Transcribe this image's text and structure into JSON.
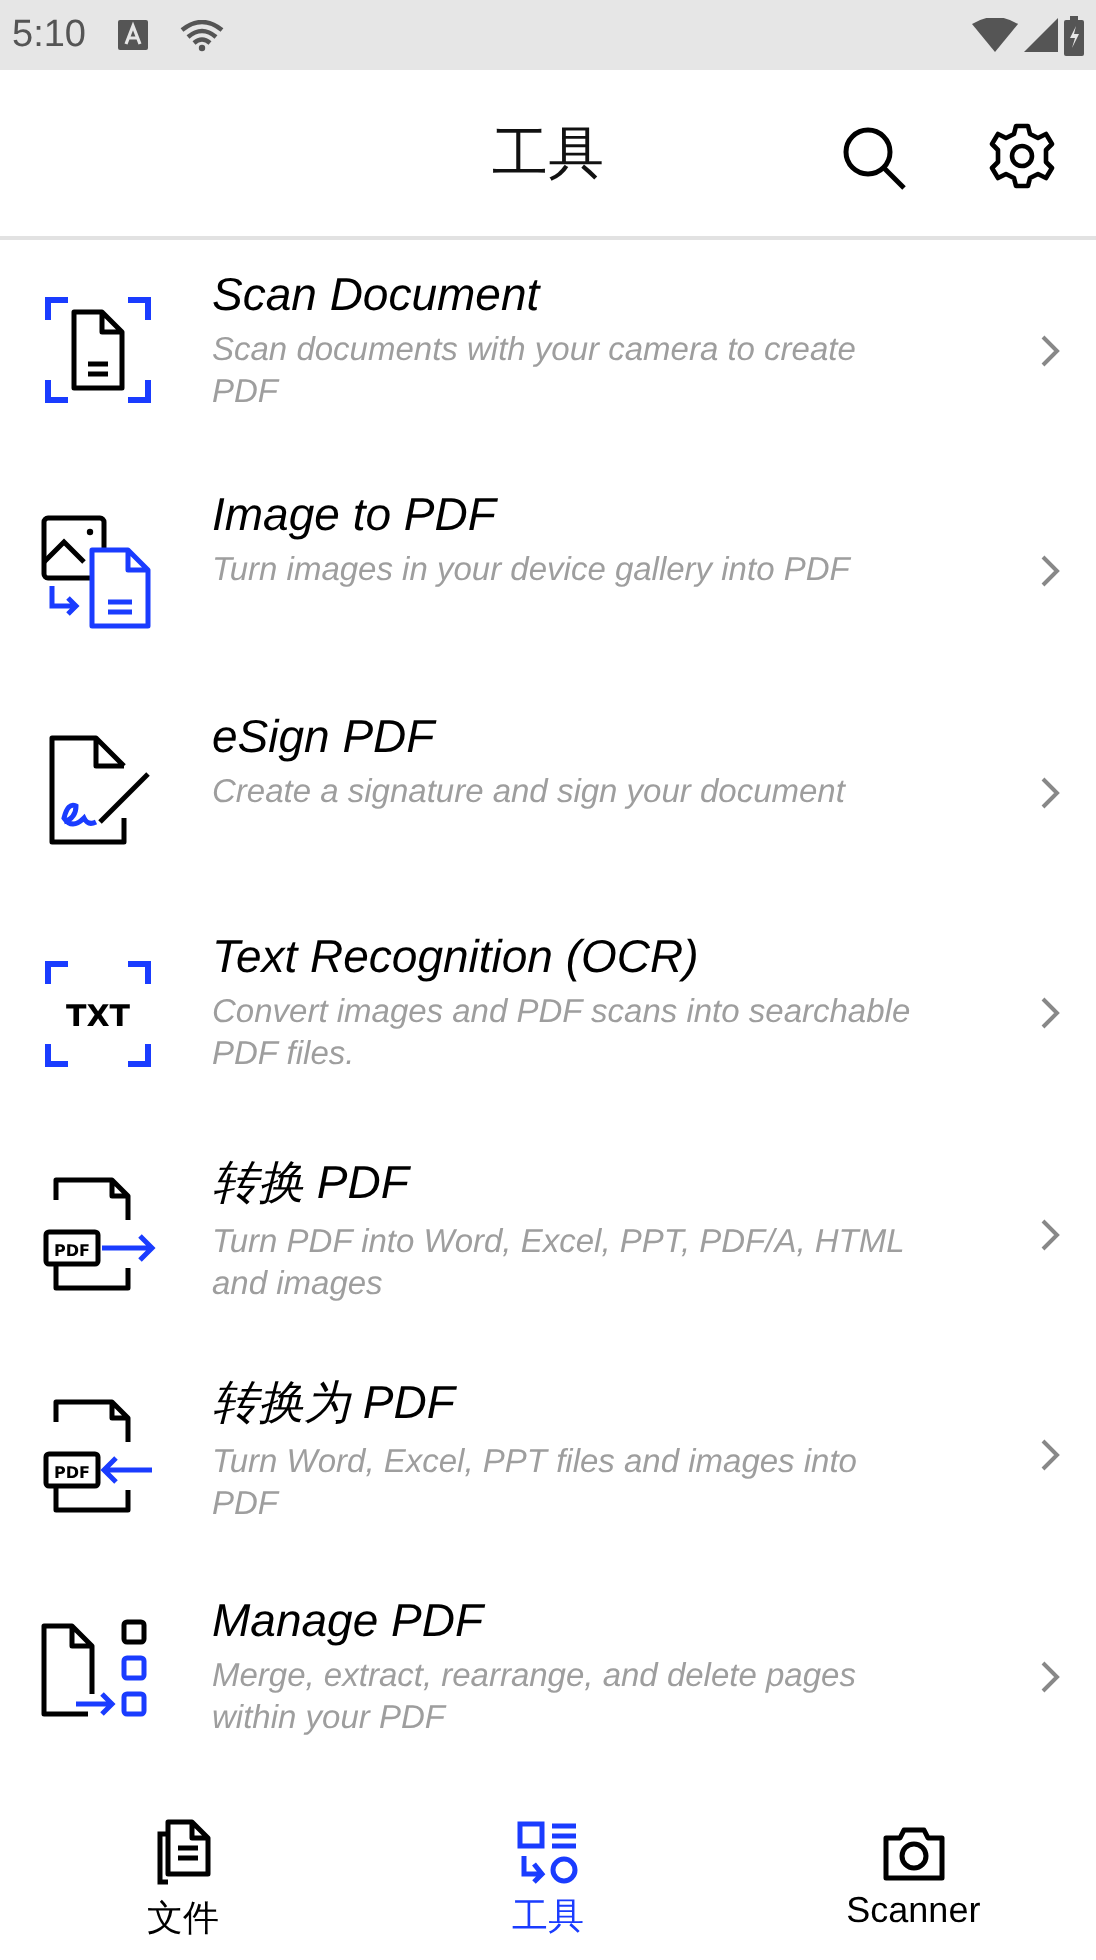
{
  "status_bar": {
    "time": "5:10"
  },
  "header": {
    "title": "工具"
  },
  "tools": [
    {
      "kind": "scan",
      "title": "Scan Document",
      "description": "Scan documents with your camera to create PDF"
    },
    {
      "kind": "image",
      "title": "Image to PDF",
      "description": "Turn images in your device gallery into PDF"
    },
    {
      "kind": "esign",
      "title": "eSign PDF",
      "description": "Create a signature and sign your document"
    },
    {
      "kind": "ocr",
      "title": "Text Recognition (OCR)",
      "description": "Convert images and PDF scans into searchable PDF files.",
      "icon_label": "TXT"
    },
    {
      "kind": "convert_from",
      "title": "转换 PDF",
      "description": "Turn PDF into Word, Excel, PPT, PDF/A, HTML and images",
      "icon_label": "PDF"
    },
    {
      "kind": "convert_to",
      "title": "转换为 PDF",
      "description": "Turn Word, Excel, PPT files and images into PDF",
      "icon_label": "PDF"
    },
    {
      "kind": "manage",
      "title": "Manage PDF",
      "description": "Merge, extract, rearrange, and delete pages within your PDF"
    }
  ],
  "bottom_nav": [
    {
      "kind": "files",
      "label": "文件",
      "selected": false
    },
    {
      "kind": "tools",
      "label": "工具",
      "selected": true
    },
    {
      "kind": "scanner",
      "label": "Scanner",
      "selected": false
    }
  ]
}
